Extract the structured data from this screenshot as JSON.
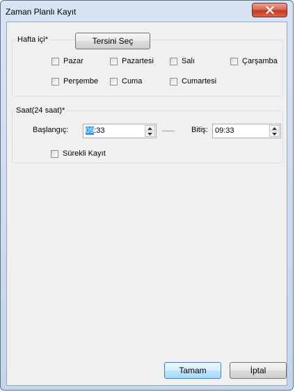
{
  "window": {
    "title": "Zaman Planlı Kayıt"
  },
  "days_group": {
    "legend": "Hafta içi*",
    "invert_button": "Tersini Seç",
    "days": [
      "Pazar",
      "Pazartesi",
      "Salı",
      "Çarşamba",
      "Perşembe",
      "Cuma",
      "Cumartesi"
    ]
  },
  "time_group": {
    "legend": "Saat(24 saat)*",
    "start_label": "Başlangıç:",
    "start_hour": "09",
    "start_rest": ":33",
    "end_label": "Bitiş:",
    "end_value": "09:33",
    "continuous_label": "Sürekli Kayıt"
  },
  "buttons": {
    "ok": "Tamam",
    "cancel": "İptal"
  },
  "colors": {
    "accent": "#3399ff",
    "close": "#c23b22"
  },
  "icons": [
    "close-icon",
    "spin-up-icon",
    "spin-down-icon"
  ]
}
